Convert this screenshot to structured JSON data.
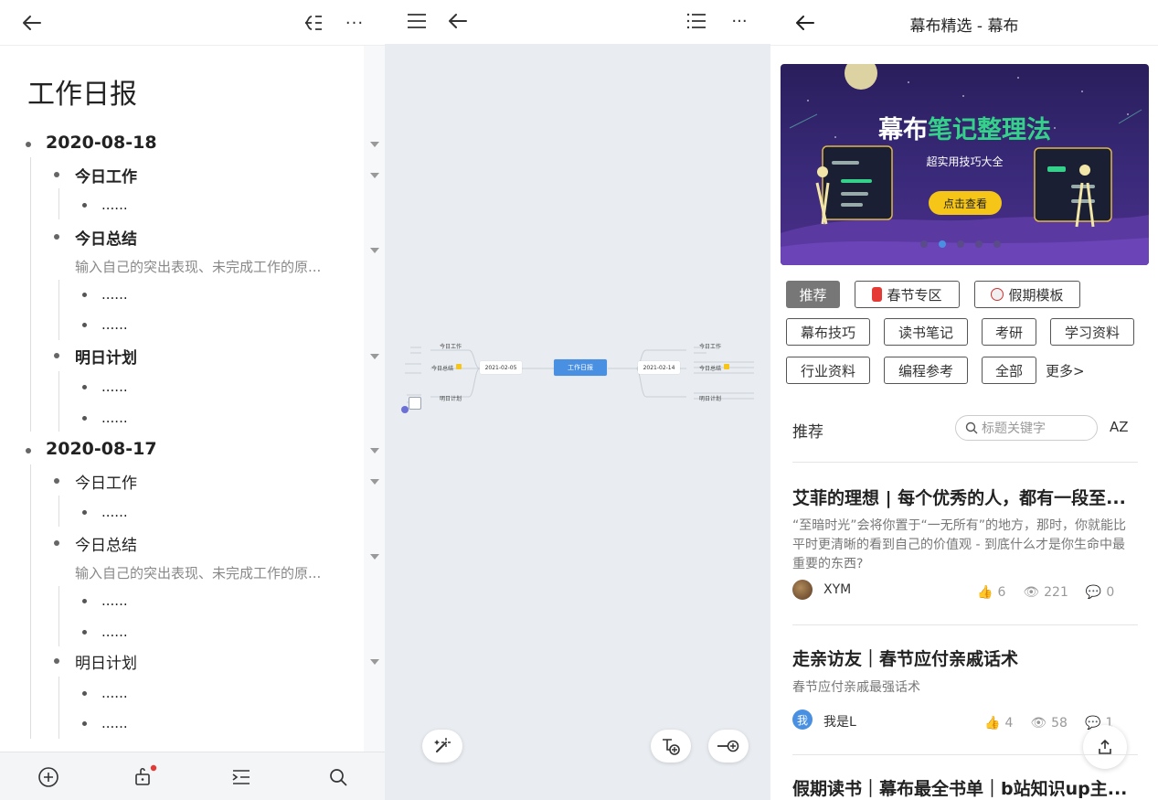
{
  "outline": {
    "title": "工作日报",
    "days": [
      {
        "date": "2020-08-18",
        "sections": [
          {
            "label": "今日工作",
            "note": "",
            "items": [
              "......"
            ]
          },
          {
            "label": "今日总结",
            "note": "输入自己的突出表现、未完成工作的原...",
            "items": [
              "......",
              "......"
            ]
          },
          {
            "label": "明日计划",
            "note": "",
            "items": [
              "......",
              "......"
            ]
          }
        ]
      },
      {
        "date": "2020-08-17",
        "sections": [
          {
            "label": "今日工作",
            "note": "",
            "items": [
              "......"
            ]
          },
          {
            "label": "今日总结",
            "note": "输入自己的突出表现、未完成工作的原...",
            "items": [
              "......",
              "......"
            ]
          },
          {
            "label": "明日计划",
            "note": "",
            "items": [
              "......",
              "......"
            ]
          }
        ]
      }
    ]
  },
  "mindmap": {
    "center": "工作日报",
    "left_date": "2021-02-05",
    "right_date": "2021-02-14",
    "left_branches": [
      "今日工作",
      "今日总结",
      "明日计划"
    ],
    "right_branches": [
      "今日工作",
      "今日总结",
      "明日计划"
    ]
  },
  "discover": {
    "header_title": "幕布精选 - 幕布",
    "banner": {
      "title_white": "幕布",
      "title_green": "笔记整理法",
      "subtitle": "超实用技巧大全",
      "button": "点击查看",
      "dots": 5,
      "active_dot": 1
    },
    "tags": [
      "推荐",
      "春节专区",
      "假期模板",
      "幕布技巧",
      "读书笔记",
      "考研",
      "学习资料",
      "行业资料",
      "编程参考",
      "全部"
    ],
    "more": "更多>",
    "section_label": "推荐",
    "search_placeholder": "标题关键字",
    "sort_label": "AZ",
    "articles": [
      {
        "title": "艾菲的理想 | 每个优秀的人，都有一段至...",
        "desc": "“至暗时光”会将你置于“一无所有”的地方，那时，你就能比平时更清晰的看到自己的价值观 - 到底什么才是你生命中最重要的东西?",
        "author": "XYM",
        "likes": "6",
        "views": "221",
        "comments": "0"
      },
      {
        "title": "走亲访友｜春节应付亲戚话术",
        "desc": "春节应付亲戚最强话术",
        "author": "我是L",
        "avatar_char": "我",
        "likes": "4",
        "views": "58",
        "comments": "1"
      },
      {
        "title": "假期读书｜幕布最全书单｜b站知识up主..."
      }
    ]
  },
  "colors": {
    "accent_blue": "#4a90e2",
    "banner_green": "#35d08a",
    "banner_yellow": "#f5c518",
    "notification_red": "#e53935"
  }
}
